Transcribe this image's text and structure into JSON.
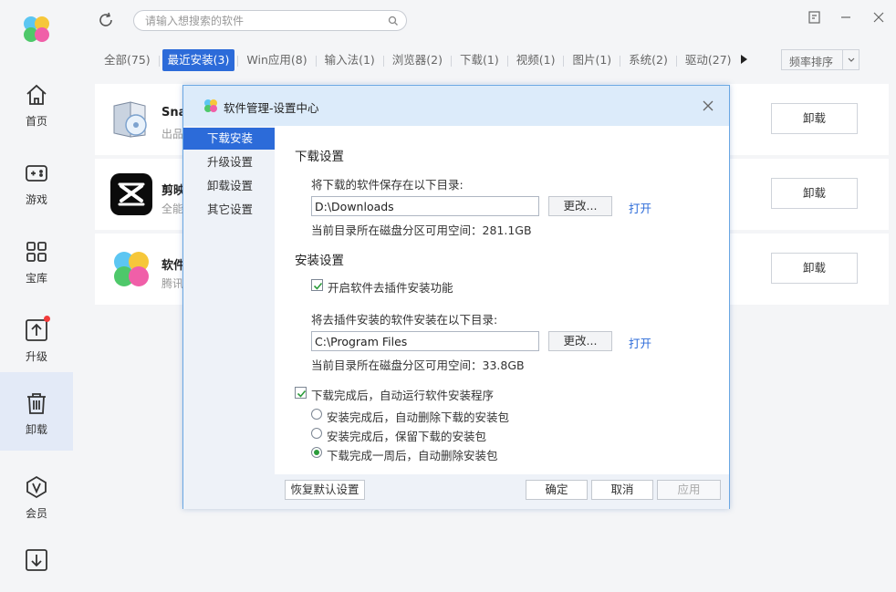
{
  "sidebar": {
    "items": [
      {
        "label": "首页",
        "icon": "home-icon"
      },
      {
        "label": "游戏",
        "icon": "gamepad-icon"
      },
      {
        "label": "宝库",
        "icon": "grid-icon"
      },
      {
        "label": "升级",
        "icon": "upgrade-icon",
        "badge": true
      },
      {
        "label": "卸载",
        "icon": "trash-icon",
        "active": true
      },
      {
        "label": "会员",
        "icon": "vip-icon"
      },
      {
        "label": "",
        "icon": "download-icon"
      }
    ]
  },
  "search": {
    "placeholder": "请输入想搜索的软件"
  },
  "tabs": [
    {
      "label": "全部(75)"
    },
    {
      "label": "最近安装(3)",
      "active": true
    },
    {
      "label": "Win应用(8)"
    },
    {
      "label": "输入法(1)"
    },
    {
      "label": "浏览器(2)"
    },
    {
      "label": "下载(1)"
    },
    {
      "label": "视频(1)"
    },
    {
      "label": "图片(1)"
    },
    {
      "label": "系统(2)"
    },
    {
      "label": "驱动(27)"
    }
  ],
  "sort": {
    "label": "频率排序"
  },
  "apps": [
    {
      "name": "Sna",
      "sub": "出品",
      "button": "卸载"
    },
    {
      "name": "剪映",
      "sub": "全能",
      "button": "卸载"
    },
    {
      "name": "软件",
      "sub": "腾讯",
      "button": "卸载"
    }
  ],
  "dialog": {
    "title": "软件管理-设置中心",
    "nav": [
      "下载安装",
      "升级设置",
      "卸载设置",
      "其它设置"
    ],
    "download": {
      "section_title": "下载设置",
      "dir_label": "将下载的软件保存在以下目录:",
      "dir_value": "D:\\Downloads",
      "change_label": "更改...",
      "open_label": "打开",
      "free_space": "当前目录所在磁盘分区可用空间：281.1GB"
    },
    "install": {
      "section_title": "安装设置",
      "plugin_checkbox": "开启软件去插件安装功能",
      "dir_label": "将去插件安装的软件安装在以下目录:",
      "dir_value": "C:\\Program Files",
      "change_label": "更改...",
      "open_label": "打开",
      "free_space": "当前目录所在磁盘分区可用空间：33.8GB"
    },
    "auto_run_checkbox": "下载完成后，自动运行软件安装程序",
    "radios": [
      {
        "label": "安装完成后，自动删除下载的安装包",
        "checked": false
      },
      {
        "label": "安装完成后，保留下载的安装包",
        "checked": false
      },
      {
        "label": "下载完成一周后，自动删除安装包",
        "checked": true
      }
    ],
    "footer": {
      "restore": "恢复默认设置",
      "ok": "确定",
      "cancel": "取消",
      "apply": "应用"
    }
  },
  "colors": {
    "accent": "#2c6bd9",
    "check_green": "#2c9c3b",
    "badge_red": "#f23b3b"
  }
}
